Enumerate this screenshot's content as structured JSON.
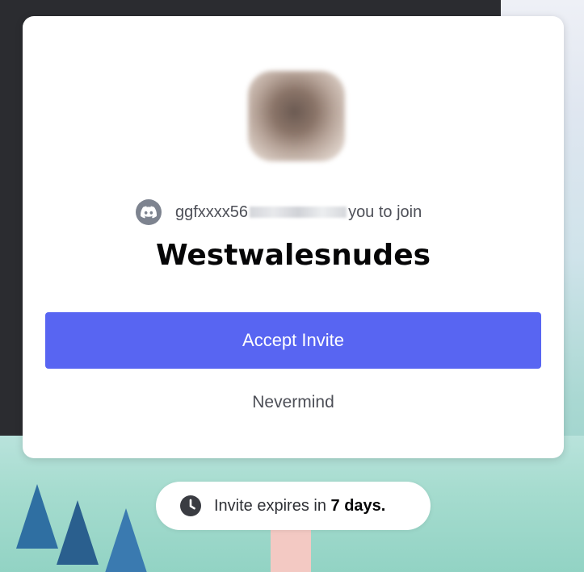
{
  "invite": {
    "inviter_prefix": "ggfxxxx56",
    "inviter_suffix": "you to join",
    "server_name": "Westwalesnudes",
    "accept_label": "Accept Invite",
    "decline_label": "Nevermind"
  },
  "expiry": {
    "prefix": "Invite expires in",
    "value": "7 days."
  },
  "icons": {
    "inviter_avatar": "discord-logo-icon",
    "expiry": "clock-icon"
  },
  "colors": {
    "accent": "#5865f2",
    "backdrop_dark": "#2b2c30",
    "avatar_bg": "#7d838f"
  }
}
